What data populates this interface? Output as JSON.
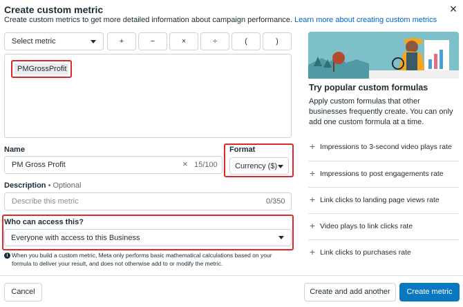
{
  "dialog": {
    "title": "Create custom metric",
    "subtitle": "Create custom metrics to get more detailed information about campaign performance.",
    "learn_more_link": "Learn more about creating custom metrics",
    "close_icon": "×"
  },
  "toolbar": {
    "select_metric": "Select metric",
    "operators": [
      "+",
      "−",
      "×",
      "÷",
      "(",
      ")"
    ]
  },
  "formula": {
    "metric_chip": "PMGrossProfit"
  },
  "name": {
    "label": "Name",
    "value": "PM Gross Profit",
    "counter": "15/100",
    "clear_icon": "×"
  },
  "format": {
    "label": "Format",
    "value": "Currency ($)"
  },
  "description": {
    "label": "Description",
    "optional": "• Optional",
    "placeholder": "Describe this metric",
    "counter": "0/350"
  },
  "access": {
    "label": "Who can access this?",
    "value": "Everyone with access to this Business"
  },
  "info_note": "When you build a custom metric, Meta only performs basic mathematical calculations based on your formula to deliver your result, and does not otherwise add to or modify the metric.",
  "popular": {
    "title": "Try popular custom formulas",
    "description": "Apply custom formulas that other businesses frequently create. You can only add one custom formula at a time.",
    "items": [
      "Impressions to 3-second video plays rate",
      "Impressions to post engagements rate",
      "Link clicks to landing page views rate",
      "Video plays to link clicks rate",
      "Link clicks to purchases rate"
    ]
  },
  "footer": {
    "cancel": "Cancel",
    "create_and_add": "Create and add another",
    "create": "Create metric"
  },
  "colors": {
    "primary": "#0a78be",
    "link": "#0064d1",
    "highlight": "#e0252b",
    "illustration_bg": "#7ec0c9"
  }
}
